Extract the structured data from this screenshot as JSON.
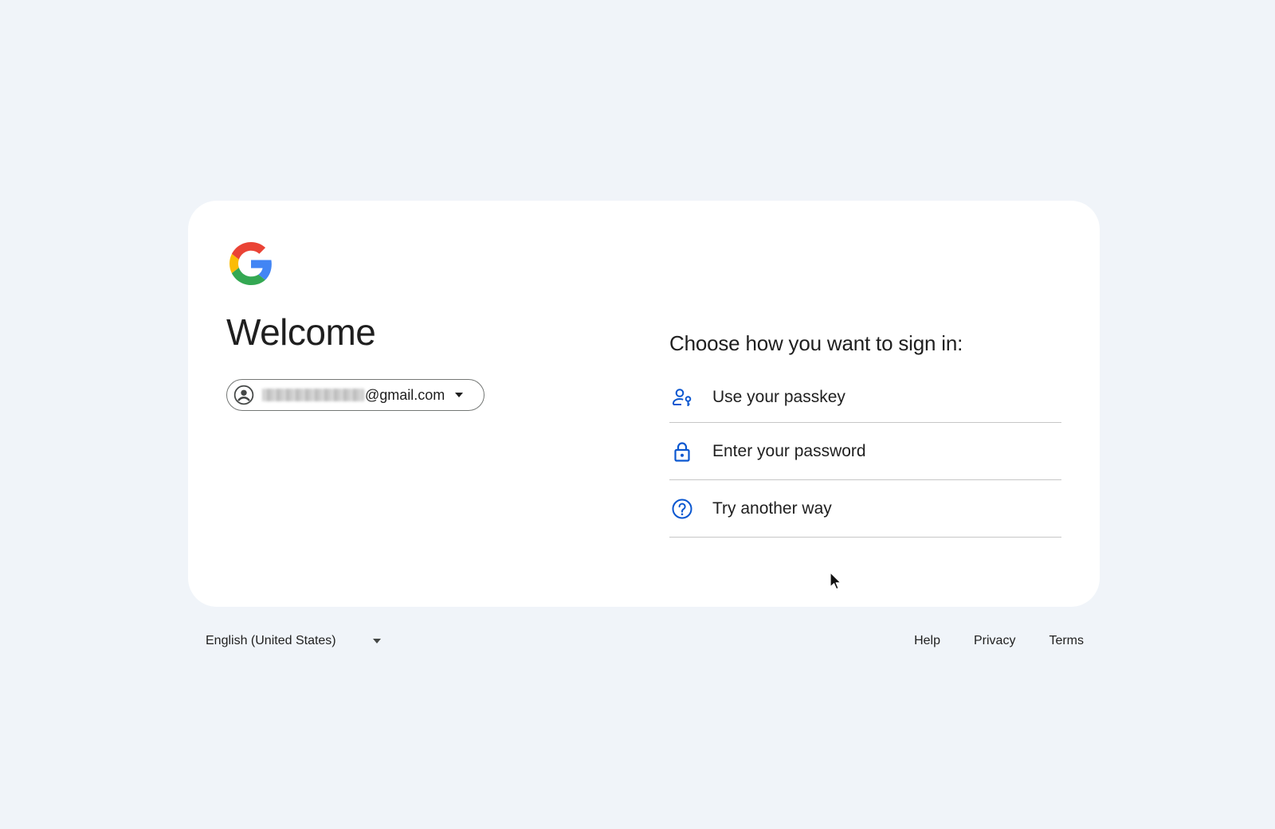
{
  "welcome": {
    "title": "Welcome",
    "account_email": "@gmail.com"
  },
  "signin": {
    "heading": "Choose how you want to sign in:",
    "options": [
      {
        "label": "Use your passkey",
        "icon": "passkey-icon"
      },
      {
        "label": "Enter your password",
        "icon": "lock-icon"
      },
      {
        "label": "Try another way",
        "icon": "help-circle-icon"
      }
    ]
  },
  "footer": {
    "language": "English (United States)",
    "links": [
      "Help",
      "Privacy",
      "Terms"
    ]
  },
  "colors": {
    "background": "#f0f4f9",
    "card": "#ffffff",
    "icon_blue": "#0b57d0",
    "text": "#1f1f1f",
    "divider": "#c7c7c7"
  }
}
